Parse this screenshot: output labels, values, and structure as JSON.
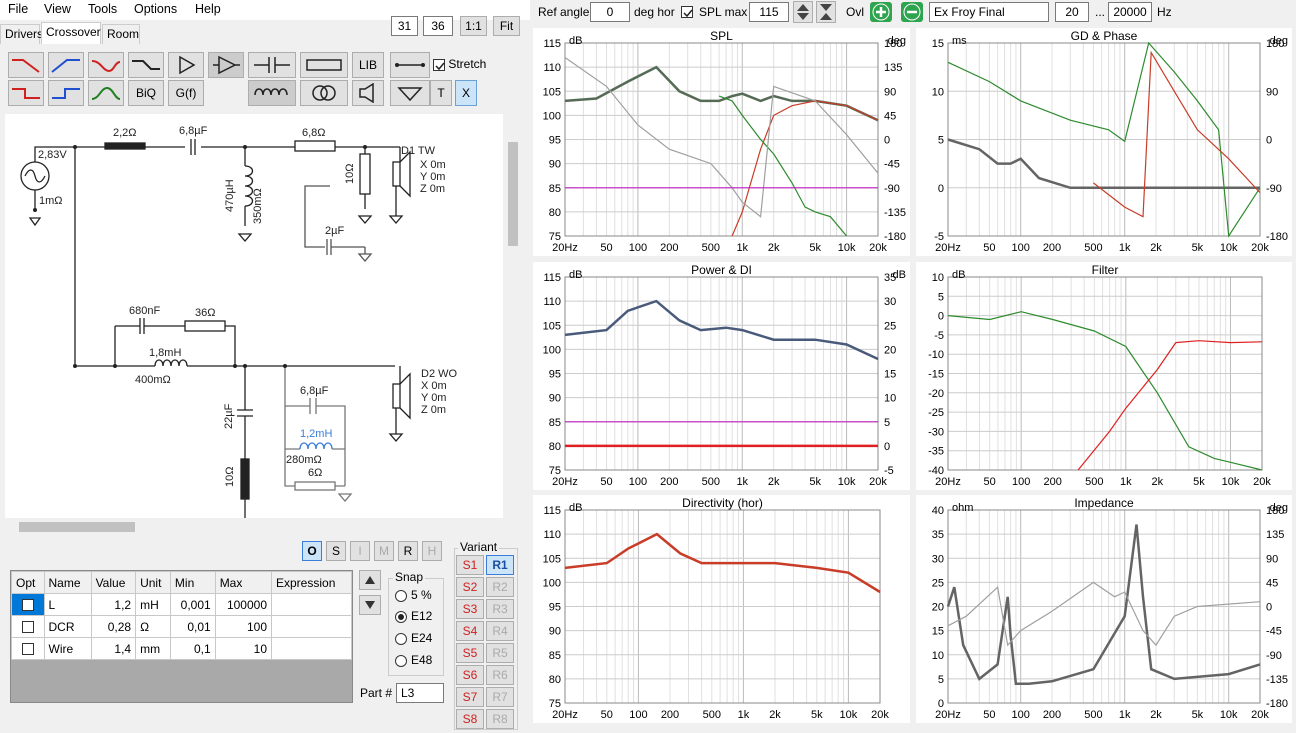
{
  "menu": [
    "File",
    "View",
    "Tools",
    "Options",
    "Help"
  ],
  "tabs": [
    "Drivers",
    "Crossover",
    "Room"
  ],
  "zoom": {
    "a": "31",
    "b": "36",
    "ratio": "1:1",
    "fit": "Fit"
  },
  "toolbar": {
    "lib": "LIB",
    "biq": "BiQ",
    "gf": "G(f)",
    "t": "T",
    "x": "X",
    "stretch": "Stretch"
  },
  "top": {
    "ref_angle_label": "Ref angle",
    "ref_angle": "0",
    "deg_hor": "deg hor",
    "spl_max_label": "SPL max",
    "spl_max": "115",
    "ovl": "Ovl",
    "name": "Ex Froy Final",
    "f_low": "20",
    "dots": "...",
    "f_high": "20000",
    "hz": "Hz"
  },
  "schematic": {
    "source_v": "2,83V",
    "source_r": "1mΩ",
    "r1": "2,2Ω",
    "c1": "6,8µF",
    "r2": "6,8Ω",
    "l1": "470µH",
    "l1r": "350mΩ",
    "r3": "10Ω",
    "c2": "2µF",
    "d1": "D1 TW",
    "d1x": "X 0m",
    "d1y": "Y 0m",
    "d1z": "Z 0m",
    "c3": "680nF",
    "r4": "36Ω",
    "l2": "1,8mH",
    "l2r": "400mΩ",
    "c4": "22µF",
    "r5": "10Ω",
    "c5": "6,8µF",
    "l3": "1,2mH",
    "l3r": "280mΩ",
    "r6": "6Ω",
    "d2": "D2 WO",
    "d2x": "X 0m",
    "d2y": "Y 0m",
    "d2z": "Z 0m"
  },
  "modes": [
    "O",
    "S",
    "I",
    "M",
    "R",
    "H"
  ],
  "params": {
    "headers": [
      "Opt",
      "Name",
      "Value",
      "Unit",
      "Min",
      "Max",
      "Expression"
    ],
    "rows": [
      [
        "L",
        "1,2",
        "mH",
        "0,001",
        "100000",
        ""
      ],
      [
        "DCR",
        "0,28",
        "Ω",
        "0,01",
        "100",
        ""
      ],
      [
        "Wire",
        "1,4",
        "mm",
        "0,1",
        "10",
        ""
      ]
    ]
  },
  "snap": {
    "title": "Snap",
    "options": [
      "5 %",
      "E12",
      "E24",
      "E48"
    ],
    "selected": "E12"
  },
  "part": {
    "label": "Part #",
    "value": "L3"
  },
  "variant": {
    "title": "Variant",
    "s": [
      "S1",
      "S2",
      "S3",
      "S4",
      "S5",
      "S6",
      "S7",
      "S8"
    ],
    "r": [
      "R1",
      "R2",
      "R3",
      "R4",
      "R5",
      "R6",
      "R7",
      "R8"
    ]
  },
  "charts": {
    "spl": {
      "title": "SPL",
      "yl": "dB",
      "yr": "deg",
      "left": [
        "115",
        "110",
        "105",
        "100",
        "95",
        "90",
        "85",
        "80",
        "75"
      ],
      "right": [
        "180",
        "135",
        "90",
        "45",
        "0",
        "-45",
        "-90",
        "-135",
        "-180"
      ]
    },
    "gd": {
      "title": "GD & Phase",
      "yl": "ms",
      "yr": "deg",
      "left": [
        "15",
        "10",
        "5",
        "0",
        "-5"
      ],
      "right": [
        "180",
        "90",
        "0",
        "-90",
        "-180"
      ]
    },
    "power": {
      "title": "Power & DI",
      "yl": "dB",
      "yr": "dB",
      "left": [
        "115",
        "110",
        "105",
        "100",
        "95",
        "90",
        "85",
        "80",
        "75"
      ],
      "right": [
        "35",
        "30",
        "25",
        "20",
        "15",
        "10",
        "5",
        "0",
        "-5"
      ]
    },
    "filter": {
      "title": "Filter",
      "yl": "dB",
      "left": [
        "10",
        "5",
        "0",
        "-5",
        "-10",
        "-15",
        "-20",
        "-25",
        "-30",
        "-35",
        "-40"
      ]
    },
    "dir": {
      "title": "Directivity (hor)",
      "yl": "dB",
      "left": [
        "115",
        "110",
        "105",
        "100",
        "95",
        "90",
        "85",
        "80",
        "75"
      ]
    },
    "imp": {
      "title": "Impedance",
      "yl": "ohm",
      "yr": "deg",
      "left": [
        "40",
        "35",
        "30",
        "25",
        "20",
        "15",
        "10",
        "5",
        "0"
      ],
      "right": [
        "180",
        "135",
        "90",
        "45",
        "0",
        "-45",
        "-90",
        "-135",
        "-180"
      ]
    },
    "xticks": [
      "20Hz",
      "50",
      "100",
      "200",
      "500",
      "1k",
      "2k",
      "5k",
      "10k",
      "20k"
    ]
  },
  "chart_data": [
    {
      "type": "line",
      "title": "SPL",
      "xlabel": "",
      "ylabel": "dB",
      "ylim": [
        75,
        115
      ],
      "y2lim": [
        -180,
        180
      ],
      "xscale": "log",
      "xlim": [
        20,
        20000
      ],
      "series": [
        {
          "color": "#556b55",
          "x": [
            20,
            40,
            80,
            150,
            250,
            400,
            600,
            800,
            1000,
            1500,
            2000,
            3000,
            5000,
            10000,
            20000
          ],
          "y": [
            103,
            103.5,
            107,
            110,
            105,
            103,
            103,
            104,
            104.5,
            103,
            104,
            103,
            103,
            102,
            99
          ]
        },
        {
          "color": "#c83c28",
          "x": [
            800,
            1000,
            1500,
            2000,
            3000,
            5000,
            10000,
            20000
          ],
          "y": [
            73,
            80,
            93,
            100,
            102,
            103,
            102,
            99
          ]
        },
        {
          "color": "#2e8b2e",
          "x": [
            600,
            800,
            1000,
            1500,
            2000,
            3000,
            4000,
            5000,
            7000,
            10000
          ],
          "y": [
            104,
            103,
            100,
            95,
            92,
            86,
            81,
            80,
            79,
            70
          ]
        },
        {
          "color": "#a0a0a0",
          "x": [
            20,
            50,
            100,
            200,
            500,
            800,
            1000,
            1500,
            2000,
            5000,
            10000,
            20000
          ],
          "y": [
            112,
            106,
            98,
            93,
            90,
            85,
            82,
            79,
            106,
            103,
            96,
            88
          ]
        },
        {
          "color": "#c020c0",
          "x": [
            20,
            20000
          ],
          "y": [
            85,
            85
          ]
        }
      ]
    },
    {
      "type": "line",
      "title": "GD & Phase",
      "ylabel": "ms",
      "ylim": [
        -5,
        15
      ],
      "xscale": "log",
      "xlim": [
        20,
        20000
      ],
      "series": [
        {
          "color": "#646464",
          "x": [
            20,
            40,
            60,
            80,
            100,
            150,
            300,
            1000,
            2000,
            5000,
            20000
          ],
          "y": [
            5,
            4,
            2.5,
            2.5,
            3,
            1,
            0,
            0,
            0,
            0,
            0
          ]
        },
        {
          "color": "#2e8b2e",
          "x": [
            20,
            50,
            100,
            300,
            700,
            1000,
            1700,
            3000,
            5000,
            8000,
            10000,
            20000
          ],
          "y": [
            13,
            11,
            9,
            7,
            6,
            4.8,
            15,
            12,
            9,
            6,
            -5,
            0
          ]
        },
        {
          "color": "#c83c28",
          "x": [
            500,
            1000,
            1500,
            1800,
            3000,
            5000,
            10000,
            20000
          ],
          "y": [
            0.5,
            -2,
            -3,
            14,
            10,
            6,
            3,
            -0.5
          ]
        }
      ]
    },
    {
      "type": "line",
      "title": "Power & DI",
      "ylabel": "dB",
      "ylim": [
        75,
        115
      ],
      "xscale": "log",
      "xlim": [
        20,
        20000
      ],
      "series": [
        {
          "color": "#4a5a7a",
          "x": [
            20,
            50,
            80,
            150,
            250,
            400,
            700,
            1000,
            2000,
            5000,
            10000,
            20000
          ],
          "y": [
            103,
            104,
            108,
            110,
            106,
            104,
            104.5,
            104,
            102,
            102,
            101,
            98
          ]
        },
        {
          "color": "#c020c0",
          "x": [
            20,
            20000
          ],
          "y": [
            85,
            85
          ]
        },
        {
          "color": "#e02020",
          "x": [
            20,
            20000
          ],
          "y": [
            80,
            80
          ]
        }
      ]
    },
    {
      "type": "line",
      "title": "Filter",
      "ylabel": "dB",
      "ylim": [
        -40,
        10
      ],
      "xscale": "log",
      "xlim": [
        20,
        20000
      ],
      "series": [
        {
          "color": "#2e8b2e",
          "x": [
            20,
            50,
            100,
            200,
            500,
            1000,
            2000,
            4000,
            7000,
            10000,
            20000
          ],
          "y": [
            0,
            -1,
            1,
            -1,
            -4,
            -8,
            -20,
            -34,
            -37,
            -38,
            -40
          ]
        },
        {
          "color": "#e02020",
          "x": [
            350,
            700,
            1000,
            2000,
            3000,
            5000,
            10000,
            20000
          ],
          "y": [
            -40,
            -30,
            -24,
            -14,
            -7,
            -6.5,
            -7,
            -6.8
          ]
        }
      ]
    },
    {
      "type": "line",
      "title": "Directivity (hor)",
      "ylabel": "dB",
      "ylim": [
        75,
        115
      ],
      "xscale": "log",
      "xlim": [
        20,
        20000
      ],
      "series": [
        {
          "color": "#c83c28",
          "x": [
            20,
            50,
            80,
            150,
            250,
            400,
            600,
            1000,
            2000,
            5000,
            10000,
            20000
          ],
          "y": [
            103,
            104,
            107,
            110,
            106,
            104,
            104,
            104,
            104,
            103,
            102,
            98
          ]
        }
      ]
    },
    {
      "type": "line",
      "title": "Impedance",
      "ylabel": "ohm",
      "ylim": [
        0,
        40
      ],
      "xscale": "log",
      "xlim": [
        20,
        20000
      ],
      "series": [
        {
          "color": "#646464",
          "x": [
            20,
            23,
            28,
            40,
            60,
            75,
            80,
            90,
            120,
            200,
            500,
            1000,
            1300,
            1500,
            1800,
            3000,
            10000,
            20000
          ],
          "y": [
            20,
            24,
            12,
            5,
            8,
            22,
            14,
            4,
            4,
            4.5,
            7,
            18,
            37,
            22,
            7,
            5,
            6,
            8
          ]
        },
        {
          "color": "#a0a0a0",
          "x": [
            20,
            30,
            60,
            75,
            100,
            200,
            500,
            800,
            1000,
            1500,
            2000,
            3000,
            5000,
            20000
          ],
          "y": [
            16,
            18,
            24,
            12,
            15,
            19,
            25,
            22,
            23,
            15,
            12,
            18,
            20,
            21
          ]
        }
      ]
    }
  ]
}
